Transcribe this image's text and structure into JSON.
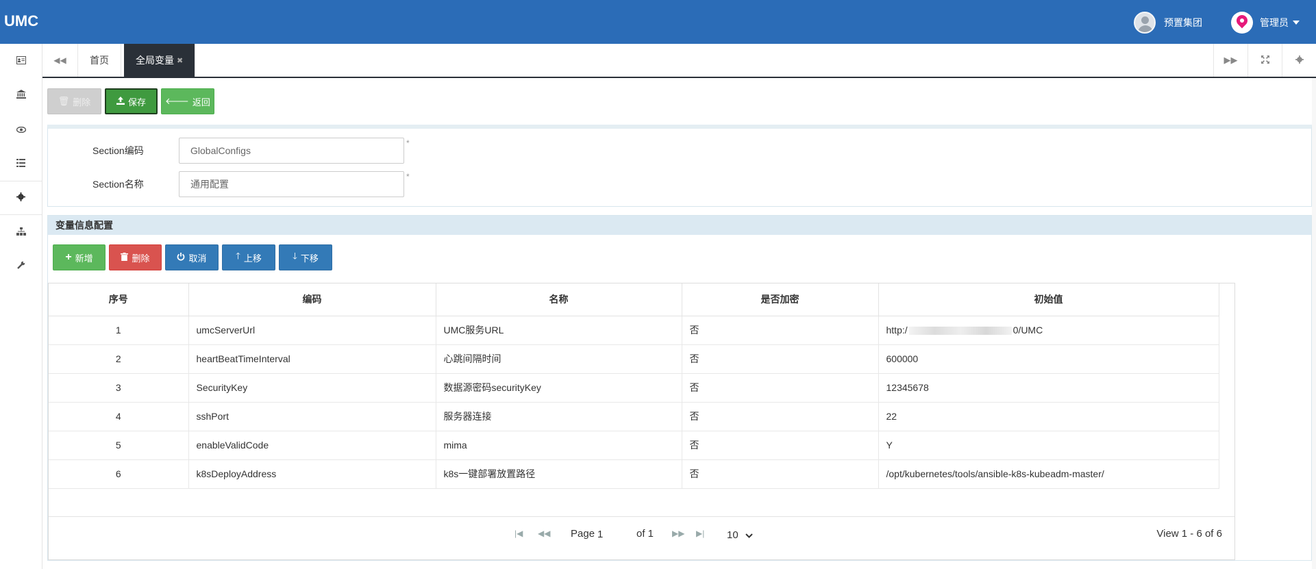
{
  "app": {
    "brand": "UMC"
  },
  "header": {
    "org_name": "预置集团",
    "user_name": "管理员"
  },
  "sidebar": {
    "items": [
      {
        "icon": "id-card-icon"
      },
      {
        "icon": "bank-icon"
      },
      {
        "icon": "eye-icon"
      },
      {
        "icon": "list-icon"
      },
      {
        "icon": "gear-icon",
        "active": true
      },
      {
        "icon": "sitemap-icon"
      },
      {
        "icon": "wrench-icon"
      }
    ]
  },
  "tabs": {
    "items": [
      {
        "label": "首页"
      },
      {
        "label": "全局变量",
        "active": true
      }
    ]
  },
  "toolbar": {
    "btn1": "删除",
    "save": "保存",
    "back": "返回"
  },
  "form": {
    "code_label": "Section编码",
    "code_value": "GlobalConfigs",
    "name_label": "Section名称",
    "name_value": "通用配置",
    "required_mark": "*"
  },
  "vars": {
    "title": "变量信息配置",
    "buttons": {
      "add": "新增",
      "delete": "删除",
      "cancel": "取消",
      "up": "上移",
      "down": "下移"
    },
    "columns": [
      "序号",
      "编码",
      "名称",
      "是否加密",
      "初始值"
    ],
    "rows": [
      {
        "seq": "1",
        "code": "umcServerUrl",
        "name": "UMC服务URL",
        "encrypted": "否",
        "init_prefix": "http:/",
        "init_suffix": "0/UMC"
      },
      {
        "seq": "2",
        "code": "heartBeatTimeInterval",
        "name": "心跳间隔时间",
        "encrypted": "否",
        "init": "600000"
      },
      {
        "seq": "3",
        "code": "SecurityKey",
        "name": "数据源密码securityKey",
        "encrypted": "否",
        "init": "12345678"
      },
      {
        "seq": "4",
        "code": "sshPort",
        "name": "服务器连接",
        "encrypted": "否",
        "init": "22"
      },
      {
        "seq": "5",
        "code": "enableValidCode",
        "name": "mima",
        "encrypted": "否",
        "init": "Y"
      },
      {
        "seq": "6",
        "code": "k8sDeployAddress",
        "name": "k8s一键部署放置路径",
        "encrypted": "否",
        "init": "/opt/kubernetes/tools/ansible-k8s-kubeadm-master/"
      }
    ],
    "pager": {
      "page_label": "Page",
      "page_value": "1",
      "of_label": "of 1",
      "page_size": "10",
      "view_text": "View 1 - 6 of 6"
    }
  }
}
